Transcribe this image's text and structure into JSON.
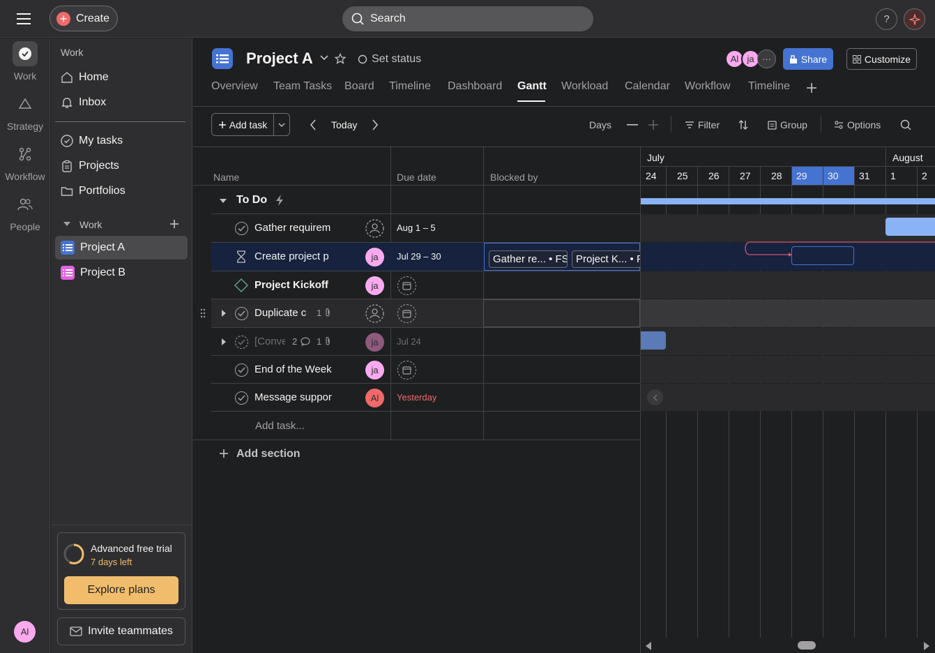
{
  "topbar": {
    "create_label": "Create",
    "search_placeholder": "Search",
    "help_label": "?"
  },
  "rail": {
    "items": [
      {
        "label": "Work",
        "icon": "check-icon"
      },
      {
        "label": "Strategy",
        "icon": "triangle-icon"
      },
      {
        "label": "Workflow",
        "icon": "workflow-icon"
      },
      {
        "label": "People",
        "icon": "people-icon"
      }
    ],
    "user_initials": "Al"
  },
  "sidebar": {
    "section_work": "Work",
    "home": "Home",
    "inbox": "Inbox",
    "my_tasks": "My tasks",
    "projects": "Projects",
    "portfolios": "Portfolios",
    "team_section": "Work",
    "project_a": "Project A",
    "project_b": "Project B",
    "trial_title": "Advanced free trial",
    "trial_days": "7 days left",
    "explore_label": "Explore plans",
    "invite_label": "Invite teammates"
  },
  "project": {
    "title": "Project A",
    "set_status": "Set status",
    "members": [
      "Al",
      "ja"
    ],
    "share_label": "Share",
    "customize_label": "Customize",
    "tabs": [
      "Overview",
      "Team Tasks",
      "Board",
      "Timeline",
      "Dashboard",
      "Gantt",
      "Workload",
      "Calendar",
      "Workflow",
      "Timeline"
    ],
    "active_tab": "Gantt"
  },
  "toolbar": {
    "add_task": "Add task",
    "today": "Today",
    "days": "Days",
    "filter": "Filter",
    "group": "Group",
    "options": "Options"
  },
  "grid": {
    "columns": [
      "Name",
      "Due date",
      "Blocked by"
    ],
    "section_name": "To Do",
    "rows": [
      {
        "name": "Gather requirem",
        "assignee": "",
        "due": "Aug 1 – 5"
      },
      {
        "name": "Create project p",
        "assignee": "ja",
        "due": "Jul 29 – 30",
        "blocked_by": [
          "Gather re... • FS",
          "Project K... • F"
        ]
      },
      {
        "name": "Project Kickoff",
        "assignee": "ja",
        "due": ""
      },
      {
        "name": "Duplicate c",
        "assignee": "",
        "due": "",
        "attachments": "1"
      },
      {
        "name": "[Conve",
        "assignee": "ja",
        "due": "Jul 24",
        "comments": "2",
        "attachments": "1"
      },
      {
        "name": "End of the Week",
        "assignee": "ja",
        "due": ""
      },
      {
        "name": "Message suppor",
        "assignee": "Al",
        "due": "Yesterday"
      }
    ],
    "add_task_placeholder": "Add task...",
    "add_section": "Add section"
  },
  "gantt": {
    "months": [
      "July",
      "August"
    ],
    "days": [
      "24",
      "25",
      "26",
      "27",
      "28",
      "29",
      "30",
      "31",
      "1",
      "2"
    ],
    "highlighted_days": [
      "29",
      "30"
    ]
  },
  "colors": {
    "accent": "#4573d2",
    "brand_red": "#f06a6a",
    "trial_gold": "#f1bd6c",
    "avatar_pink": "#f9aaef",
    "overdue": "#f06a6a"
  }
}
